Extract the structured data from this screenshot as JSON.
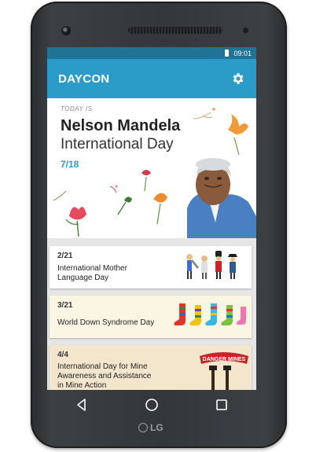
{
  "status": {
    "time": "09:01"
  },
  "app": {
    "title": "DAYCON",
    "settings_icon": "gear-icon"
  },
  "hero": {
    "label": "TODAY IS",
    "title_line1": "Nelson Mandela",
    "title_line2": "International Day",
    "date": "7/18"
  },
  "cards": [
    {
      "date": "2/21",
      "name_line1": "International Mother",
      "name_line2": "Language Day",
      "name_line3": "",
      "art_icon": "people-icon"
    },
    {
      "date": "3/21",
      "name_line1": "World Down Syndrome Day",
      "name_line2": "",
      "name_line3": "",
      "art_icon": "socks-icon"
    },
    {
      "date": "4/4",
      "name_line1": "International Day for Mine",
      "name_line2": "Awareness and Assistance",
      "name_line3": "in Mine Action",
      "art_icon": "danger-mines-sign",
      "art_text": "DANGER MINES"
    }
  ],
  "device": {
    "brand": "LG"
  },
  "nav": {
    "back_icon": "back-icon",
    "home_icon": "home-icon",
    "recents_icon": "recents-icon"
  },
  "colors": {
    "appbar": "#2b9cc7",
    "statusbar": "#1f7394",
    "accent": "#2b9cc7"
  }
}
